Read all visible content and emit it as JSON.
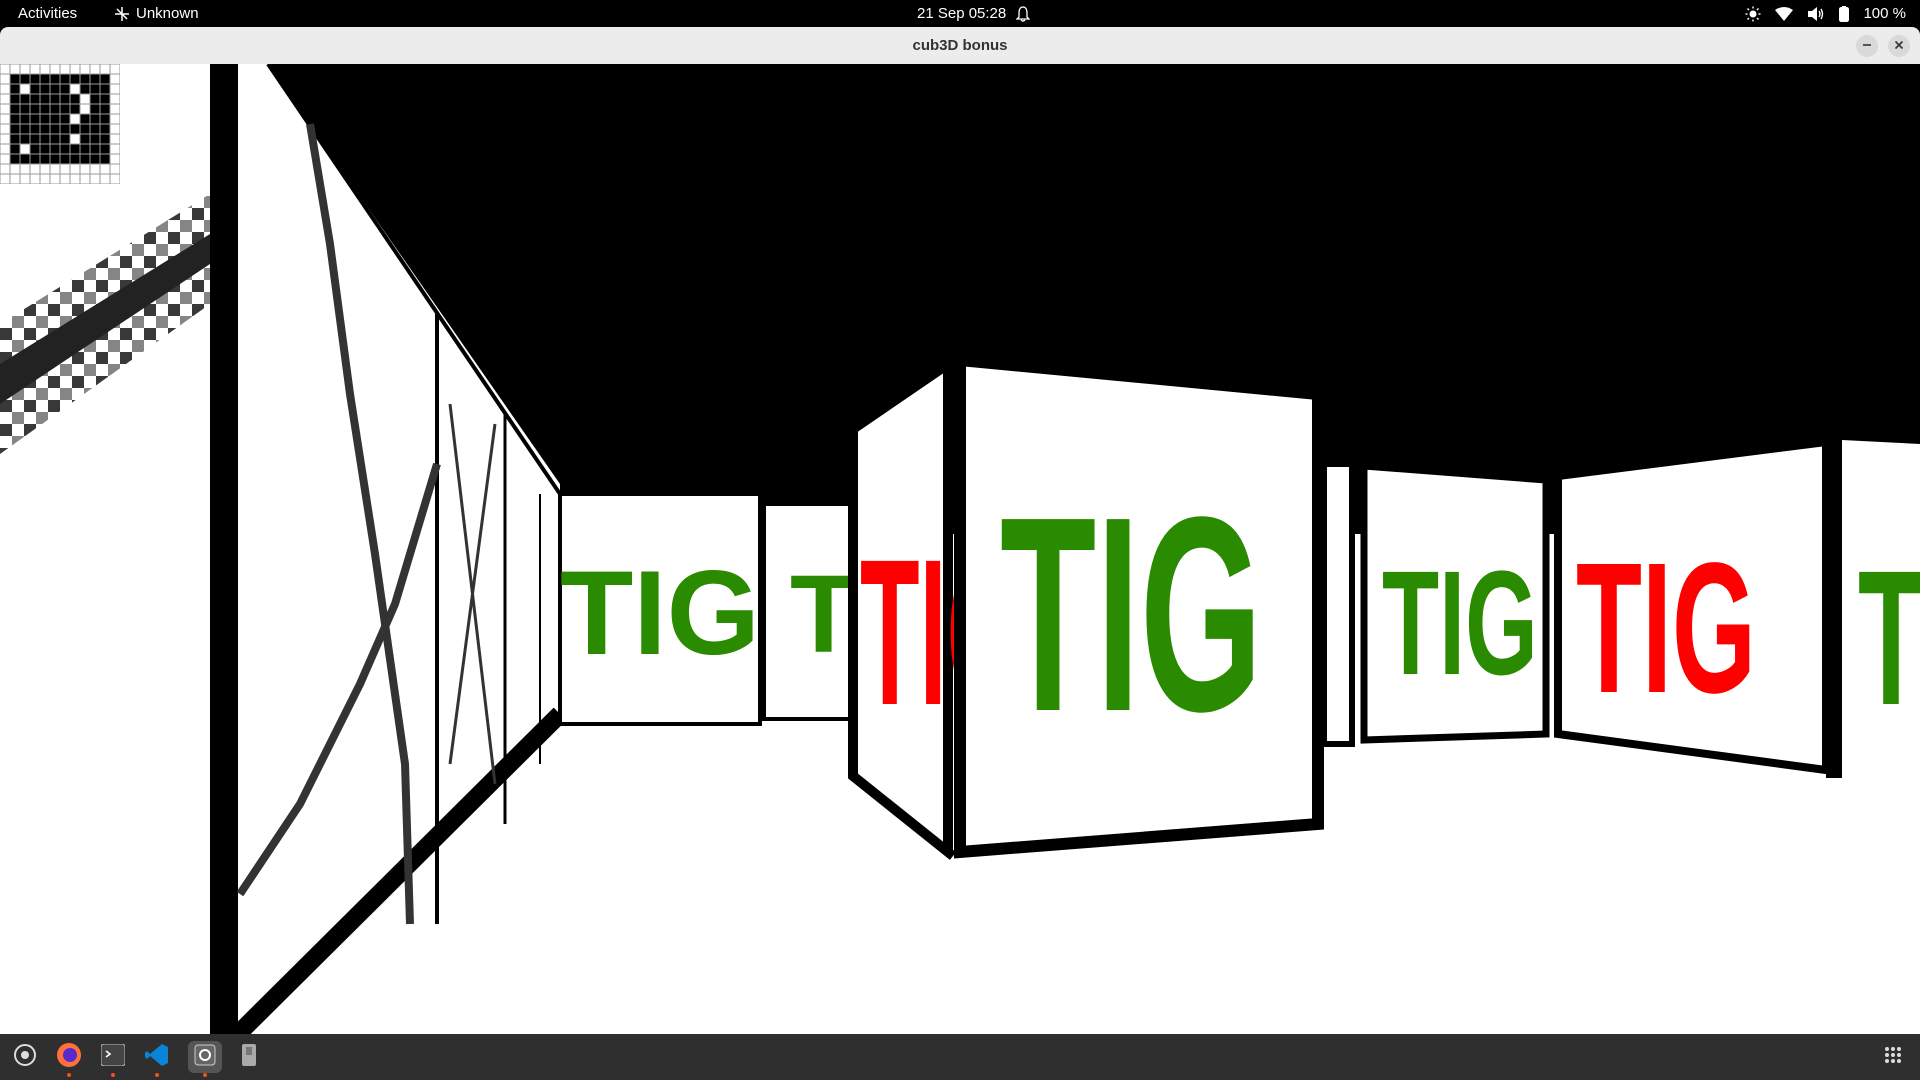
{
  "topbar": {
    "activities": "Activities",
    "app_menu": "Unknown",
    "clock": "21 Sep  05:28",
    "battery": "100 %"
  },
  "window": {
    "title": "cub3D bonus"
  },
  "scene": {
    "wall_text": "TIG",
    "ceiling_color": "#000000",
    "floor_color": "#ffffff",
    "text_colors": {
      "green": "#2a8a00",
      "red": "#ff0000"
    }
  },
  "minimap": {
    "grid": [
      "111111111111",
      "100000000001",
      "101000010001",
      "100000001001",
      "100000001001",
      "100000010001",
      "100000000001",
      "100000010001",
      "101000000001",
      "100000000001",
      "111111111111",
      "111111111111"
    ]
  },
  "dock": {
    "items": [
      "settings-icon",
      "firefox-icon",
      "terminal-icon",
      "vscode-icon",
      "cub3d-app-icon",
      "usb-drive-icon"
    ],
    "apps_grid": "show-apps-icon"
  }
}
